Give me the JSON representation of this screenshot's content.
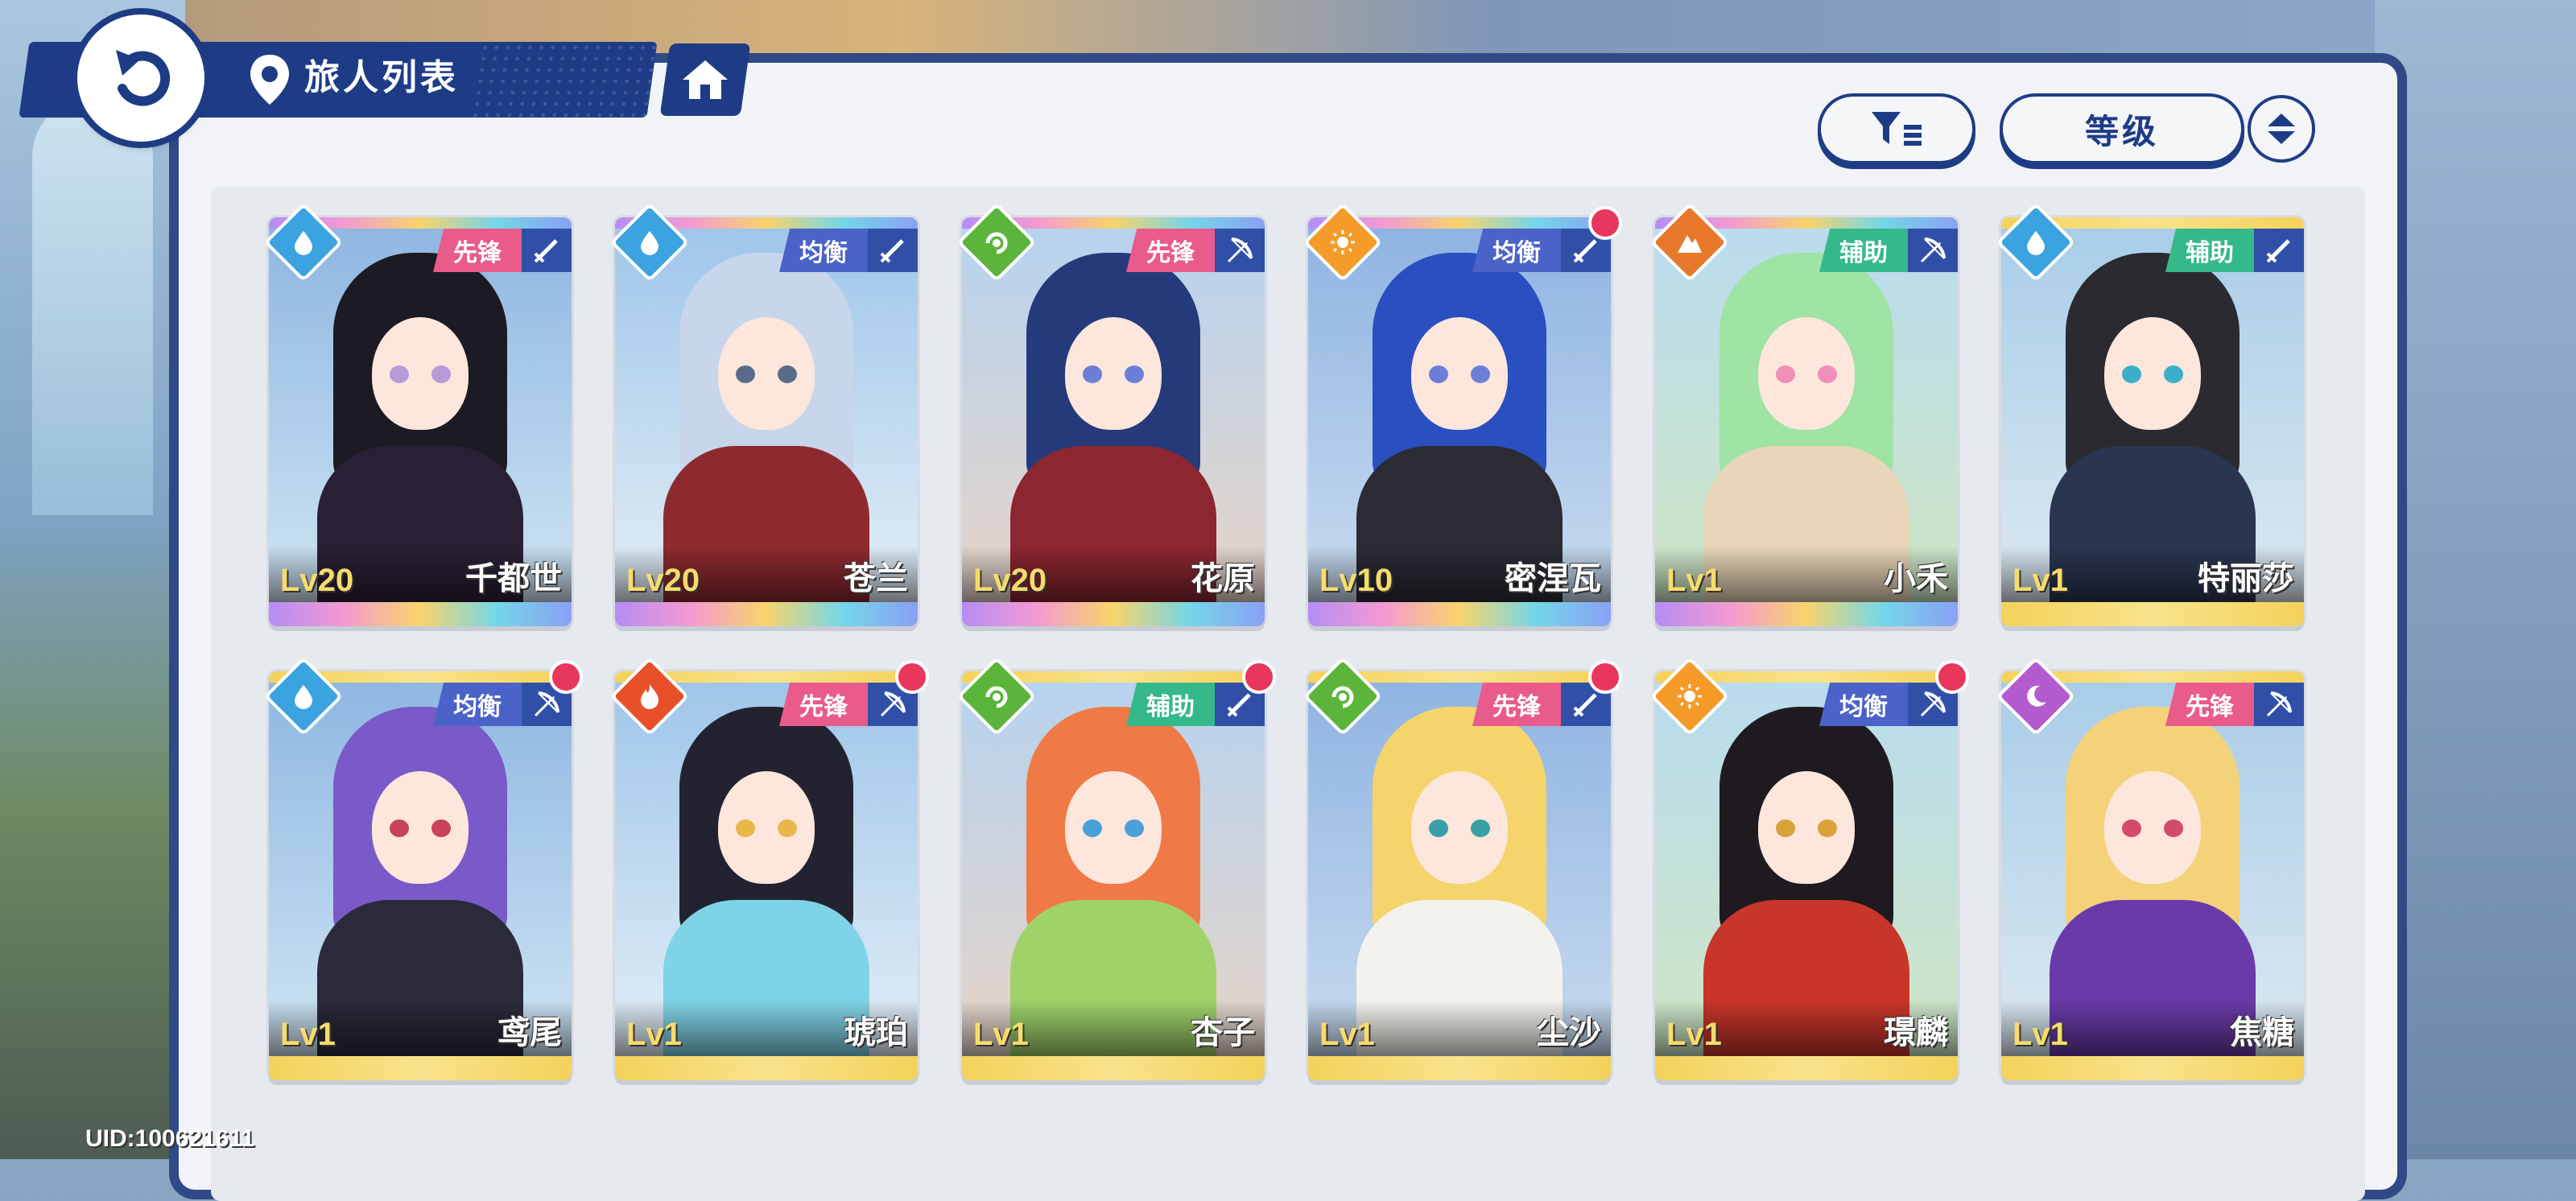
{
  "header": {
    "title": "旅人列表"
  },
  "controls": {
    "sort_label": "等级"
  },
  "uid": "UID:100621611",
  "colors": {
    "accent": "#1e3c86",
    "role_vanguard": "#e85b8a",
    "role_balance": "#4b62c8",
    "role_support": "#35b98a",
    "notification": "#e8365d"
  },
  "characters": [
    {
      "name": "千都世",
      "level": "Lv20",
      "role": "先锋",
      "element": "water-drop-icon",
      "weapon": "sword-icon",
      "rarity": "rainbow",
      "notify": false
    },
    {
      "name": "苍兰",
      "level": "Lv20",
      "role": "均衡",
      "element": "water-drop-icon",
      "weapon": "sword-icon",
      "rarity": "rainbow",
      "notify": false
    },
    {
      "name": "花原",
      "level": "Lv20",
      "role": "先锋",
      "element": "wind-swirl-icon",
      "weapon": "bow-icon",
      "rarity": "rainbow",
      "notify": false
    },
    {
      "name": "密涅瓦",
      "level": "Lv10",
      "role": "均衡",
      "element": "sun-icon",
      "weapon": "sword-icon",
      "rarity": "rainbow",
      "notify": true
    },
    {
      "name": "小禾",
      "level": "Lv1",
      "role": "辅助",
      "element": "mountain-icon",
      "weapon": "bow-icon",
      "rarity": "rainbow",
      "notify": false
    },
    {
      "name": "特丽莎",
      "level": "Lv1",
      "role": "辅助",
      "element": "water-drop-icon",
      "weapon": "sword-icon",
      "rarity": "gold",
      "notify": false
    },
    {
      "name": "鸢尾",
      "level": "Lv1",
      "role": "均衡",
      "element": "water-drop-icon",
      "weapon": "bow-icon",
      "rarity": "gold",
      "notify": true
    },
    {
      "name": "琥珀",
      "level": "Lv1",
      "role": "先锋",
      "element": "fire-icon",
      "weapon": "bow-icon",
      "rarity": "gold",
      "notify": true
    },
    {
      "name": "杏子",
      "level": "Lv1",
      "role": "辅助",
      "element": "wind-swirl-icon",
      "weapon": "sword-icon",
      "rarity": "gold",
      "notify": true
    },
    {
      "name": "尘沙",
      "level": "Lv1",
      "role": "先锋",
      "element": "wind-swirl-icon",
      "weapon": "sword-icon",
      "rarity": "gold",
      "notify": true
    },
    {
      "name": "璟麟",
      "level": "Lv1",
      "role": "均衡",
      "element": "sun-icon",
      "weapon": "bow-icon",
      "rarity": "gold",
      "notify": true
    },
    {
      "name": "焦糖",
      "level": "Lv1",
      "role": "先锋",
      "element": "moon-icon",
      "weapon": "bow-icon",
      "rarity": "gold",
      "notify": false
    }
  ]
}
